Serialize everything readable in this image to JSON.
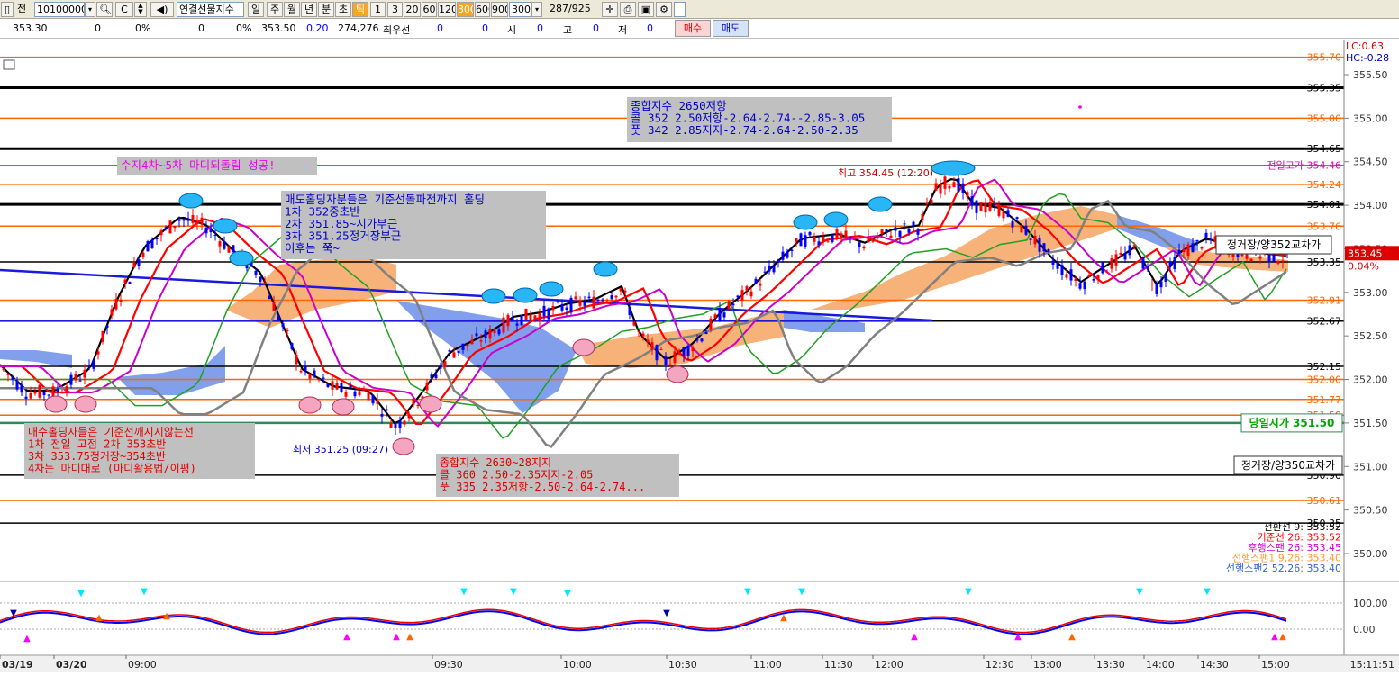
{
  "toolbar": {
    "code": "10100000",
    "item_name": "연결선물지수",
    "period_buttons": [
      "일",
      "주",
      "월",
      "년",
      "분",
      "초",
      "틱"
    ],
    "active_period": "틱",
    "interval_buttons": [
      "1",
      "3",
      "20",
      "60",
      "120",
      "300",
      "600",
      "900"
    ],
    "active_interval": "300",
    "interval_value": "300",
    "position_counter": "287/925",
    "first_label": "전"
  },
  "infobar": {
    "price": "353.30",
    "change1": "0",
    "pct1": "0%",
    "change2": "0",
    "pct2": "0%",
    "last": "353.50",
    "diff": "0.20",
    "volume": "274,276",
    "best_label": "최우선",
    "best1": "0",
    "best2": "0",
    "open_label": "시",
    "open": "0",
    "high_label": "고",
    "high": "0",
    "low_label": "저",
    "low": "0",
    "buy_label": "매수",
    "sell_label": "매도"
  },
  "chart_data": {
    "type": "line",
    "title": "",
    "ylim": [
      349.7,
      355.8
    ],
    "y_ticks": [
      "355.50",
      "355.00",
      "354.50",
      "354.00",
      "353.50",
      "353.00",
      "352.50",
      "352.00",
      "351.50",
      "351.00",
      "350.50",
      "350.00"
    ],
    "x_ticks": [
      "03/19",
      "03/20",
      "09:00",
      "09:30",
      "10:00",
      "10:30",
      "11:00",
      "11:30",
      "12:00",
      "12:30",
      "13:00",
      "13:30",
      "14:00",
      "14:30",
      "15:00"
    ],
    "clock": "15:11:51",
    "top_right": {
      "lc": "LC:0.63",
      "hc": "HC:-0.28"
    },
    "level_labels": [
      {
        "value": 355.7,
        "text": "355.70",
        "color": "#ff6600"
      },
      {
        "value": 355.35,
        "text": "355.35",
        "color": "#000000"
      },
      {
        "value": 355.0,
        "text": "355.00",
        "color": "#ff6600"
      },
      {
        "value": 354.65,
        "text": "354.65",
        "color": "#000000"
      },
      {
        "value": 354.24,
        "text": "354.24",
        "color": "#ff6600"
      },
      {
        "value": 354.01,
        "text": "354.01",
        "color": "#000000"
      },
      {
        "value": 353.76,
        "text": "353.76",
        "color": "#ff6600"
      },
      {
        "value": 353.35,
        "text": "353.35",
        "color": "#000000"
      },
      {
        "value": 352.91,
        "text": "352.91",
        "color": "#ff6600"
      },
      {
        "value": 352.67,
        "text": "352.67",
        "color": "#000000"
      },
      {
        "value": 352.15,
        "text": "352.15",
        "color": "#000000"
      },
      {
        "value": 352.0,
        "text": "352.00",
        "color": "#ff6600"
      },
      {
        "value": 351.77,
        "text": "351.77",
        "color": "#ff6600"
      },
      {
        "value": 351.59,
        "text": "351.59",
        "color": "#ff6600"
      },
      {
        "value": 350.9,
        "text": "350.90",
        "color": "#000000"
      },
      {
        "value": 350.61,
        "text": "350.61",
        "color": "#ff6600"
      },
      {
        "value": 350.35,
        "text": "350.35",
        "color": "#000000"
      }
    ],
    "last_price": {
      "value": 353.45,
      "text": "353.45",
      "pct": "0.04%"
    },
    "prev_high": {
      "text": "전일고가 354.46"
    },
    "day_open": {
      "text": "당일시가 351.50"
    },
    "high_mark": {
      "text": "최고 354.45 (12:20)"
    },
    "low_mark": {
      "text": "최저 351.25 (09:27)"
    },
    "right_tags": [
      "정거장/양352교차가",
      "정거장/양350교차가"
    ],
    "legend": [
      {
        "text": "전환선 9: 353.52",
        "color": "#000000"
      },
      {
        "text": "기준선 26: 353.52",
        "color": "#ff0000"
      },
      {
        "text": "후행스팬 26: 353.45",
        "color": "#cc00cc"
      },
      {
        "text": "선행스팬1 9,26: 353.40",
        "color": "#ff9933"
      },
      {
        "text": "선행스팬2 52,26: 353.40",
        "color": "#3366cc"
      }
    ],
    "osc_ticks": [
      "100.00",
      "0.00"
    ]
  },
  "annotations": {
    "a1": {
      "lines": [
        "종합지수  2650저항",
        "콜  352  2.50저항-2.64-2.74--2.85-3.05",
        "풋  342  2.85지지-2.74-2.64-2.50-2.35"
      ]
    },
    "a2": {
      "lines": [
        "수지4차~5차  마디되돌림  성공!"
      ]
    },
    "a3": {
      "lines": [
        "매도홀딩자분들은  기준선돌파전까지  홀딩",
        "1차  352중초반",
        "2차  351.85~시가부근",
        "3차  351.25정거장부근",
        "이후는  쭉~"
      ]
    },
    "a4": {
      "lines": [
        "매수홀딩자들은  기준선깨지지않는선",
        "1차  전일  고점   2차  353초반",
        "3차  353.75정거장~354초반",
        "4차는  마디대로 (마디활용법/이평)"
      ]
    },
    "a5": {
      "lines": [
        "종합지수  2630~28지지",
        "콜  360  2.50-2.35지지-2.05",
        "풋  335  2.35저항-2.50-2.64-2.74..."
      ]
    }
  },
  "colors": {
    "orange_line": "#ff6600",
    "black_line": "#000000",
    "blue_trend": "#1a1adc",
    "cloud_orange": "#f4a460",
    "cloud_blue": "#6b8ee8",
    "candle_up": "#ff0000",
    "candle_down": "#0000ff",
    "annotation_bg": "#c0c0c0"
  }
}
